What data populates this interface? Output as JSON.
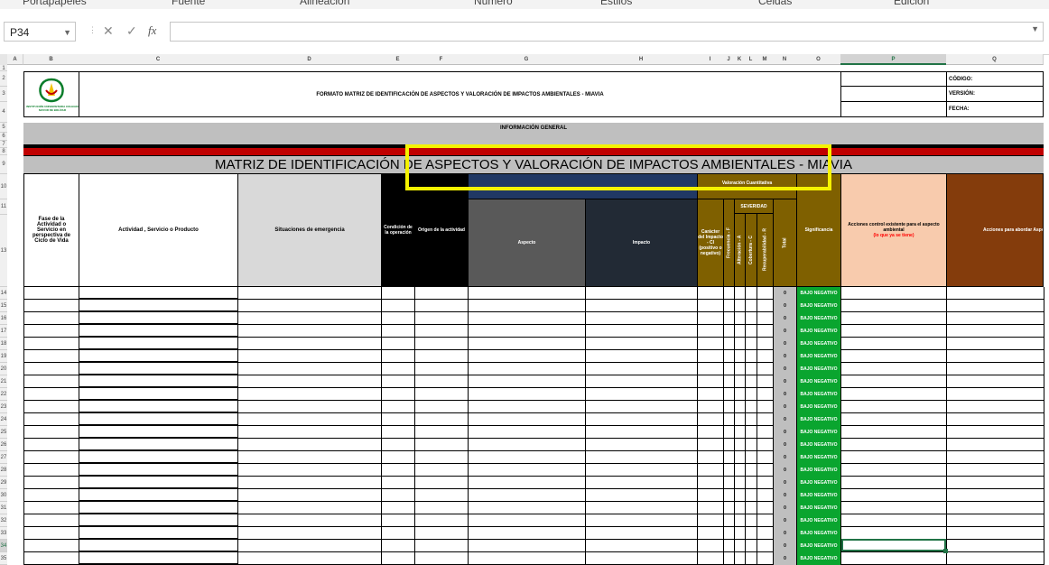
{
  "ribbon": {
    "groups": [
      "Portapapeles",
      "Fuente",
      "Alineación",
      "Número",
      "Estilos",
      "Celdas",
      "Edición"
    ]
  },
  "formula_bar": {
    "name_box": "P34",
    "cancel_glyph": "✕",
    "enter_glyph": "✓",
    "fx_glyph": "fx",
    "value": ""
  },
  "columns": [
    "A",
    "B",
    "C",
    "D",
    "E",
    "F",
    "G",
    "H",
    "I",
    "J",
    "K",
    "L",
    "M",
    "N",
    "O",
    "P",
    "Q"
  ],
  "selected_column": "P",
  "rows": [
    "1",
    "2",
    "3",
    "4",
    "5",
    "6",
    "7",
    "8",
    "9",
    "10",
    "11",
    "12",
    "13",
    "14",
    "15",
    "16",
    "17",
    "18",
    "19",
    "20",
    "21",
    "22",
    "23",
    "24",
    "25",
    "26",
    "27",
    "28",
    "29",
    "30",
    "31",
    "32",
    "33",
    "34",
    "35"
  ],
  "selected_row": "34",
  "sheet": {
    "form_title": "FORMATO MATRIZ DE IDENTIFICACIÓN DE ASPECTOS Y VALORACIÓN DE IMPACTOS AMBIENTALES - MIAVIA",
    "logo_text": "INSTITUCIÓN UNIVERSITARIA COLEGIO MAYOR DE BOLÍVAR",
    "codigo": "CÓDIGO:",
    "version": "VERSIÓN:",
    "fecha": "FECHA:",
    "info_general": "INFORMACIÓN GENERAL",
    "matrix_title": "MATRIZ DE IDENTIFICACIÓN DE ASPECTOS Y VALORACIÓN DE IMPACTOS AMBIENTALES - MIAVIA",
    "headers": {
      "fase": "Fase de la Actividad o Servicio en perspectiva de Ciclo de Vida",
      "actividad": "Actividad , Servicio o Producto",
      "situaciones": "Situaciones de emergencia",
      "condicion": "Condición de la operación",
      "origen": "Origen de la actividad",
      "aspecto": "Aspecto",
      "impacto": "Impacto",
      "valoracion": "Valoración Cuantitativa",
      "caracter": "Carácter del Impacto - CI (positivo o negativo)",
      "frecuencia": "Frecuencia - F",
      "severidad": "SEVERIDAD",
      "alteracion": "Alteración - A",
      "cobertura": "Cobertura - C",
      "recuperabilidad": "Recuperabilidad - R",
      "total": "Total",
      "significancia": "Significancia",
      "acciones_control_1": "Acciones control existente para el aspecto ambiental",
      "acciones_control_2": "(lo que ya se tiene)",
      "acciones_abordar": "Acciones para abordar Aspectos Significativos"
    },
    "row_total": "0",
    "row_significancia": "BAJO NEGATIVO"
  },
  "colors": {
    "excel_green": "#217346",
    "gray_header": "#bfbfbf",
    "dark_red": "#c00000",
    "black": "#000000",
    "aspect_gray": "#595959",
    "impact_navy": "#222a35",
    "olive": "#7f6000",
    "green_badge": "#0aa52f",
    "salmon": "#f8cbad",
    "brown": "#843c0c",
    "highlight_yellow": "#f5f200"
  }
}
